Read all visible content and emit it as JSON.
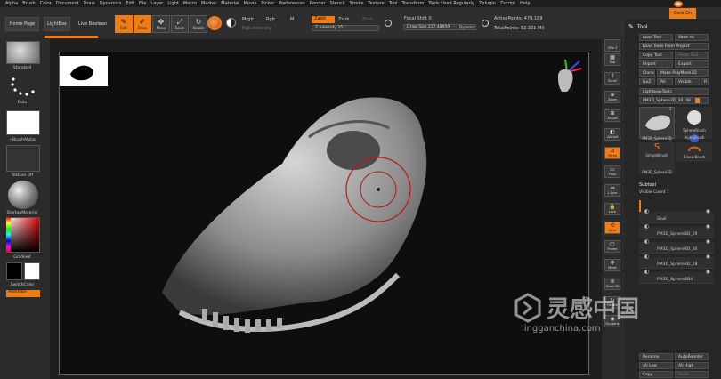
{
  "menu": [
    "Alpha",
    "Brush",
    "Color",
    "Document",
    "Draw",
    "Dynamics",
    "Edit",
    "File",
    "Layer",
    "Light",
    "Macro",
    "Marker",
    "Material",
    "Movie",
    "Picker",
    "Preferences",
    "Render",
    "Stencil",
    "Stroke",
    "Texture",
    "Tool",
    "Transform",
    "Tools Used Regularly",
    "Zplugin",
    "Zscript",
    "Help"
  ],
  "coords": "-1.253 0.346,-1.336",
  "tabs": {
    "home": "Home Page",
    "lightbox": "LightBox",
    "live_boolean": "Live Boolean"
  },
  "toolbar": {
    "edit": "Edit",
    "draw": "Draw",
    "move": "Move",
    "scale": "Scale",
    "rotate": "Rotate",
    "mrgb": "Mrgb",
    "rgb": "Rgb",
    "m": "M",
    "rgb_intensity": "Rgb Intensity",
    "zadd": "Zadd",
    "zsub": "Zsub",
    "zcut": "Zcut",
    "z_intensity": "Z Intensity 25",
    "focal_shift": "Focal Shift 0",
    "draw_size": "Draw Size 217.48959",
    "dynamic": "Dynamic",
    "active_points": "ActivePoints: 479,189",
    "total_points": "TotalPoints: 52.321 Mil"
  },
  "colors": {
    "accent": "#f07d14",
    "background": "#2a2a2a"
  },
  "top_right": {
    "core_on": "Core On"
  },
  "left_shelf": {
    "standard": "Standard",
    "dots": "Dots",
    "brush_alpha": "~BrushAlpha",
    "texture_off": "Texture Off",
    "startup_material": "StartupMaterial",
    "gradient": "Gradient",
    "switch_color": "SwitchColor",
    "alternate": "Alternate"
  },
  "right_shelf": [
    "Sub",
    "Scroll",
    "Zoom",
    "Actual",
    "AAHalf",
    "Persp",
    "Floor",
    "L.Sym",
    "Lock",
    "Qxyz",
    "Frame",
    "Move",
    "Zoom3D",
    "Rotate",
    "Sculptris"
  ],
  "right_shelf_top": "SPix 3",
  "tool_palette": {
    "title": "Tool",
    "load_tool": "Load Tool",
    "save_as": "Save As",
    "load_from_project": "Load Tools From Project",
    "copy_tool": "Copy Tool",
    "paste_tool": "Paste Tool",
    "import": "Import",
    "export": "Export",
    "clone": "Clone",
    "make_polymesh": "Make PolyMesh3D",
    "goz": "GoZ",
    "all": "All",
    "visible": "Visible",
    "r": "R",
    "lightbox_tools": "Lightbox▸Tools",
    "current_tool": "PM3D_Sphere3D_30. 48",
    "thumb_pm3d": "PM3D_Sphere3D",
    "sphere_brush": "SphereBrush",
    "alpha_brush": "AlphaBrush",
    "simple_brush": "SimpleBrush",
    "eraser_brush": "EraserBrush",
    "thumb_count": "2",
    "subtool_title": "Subtool",
    "visible_count": "Visible Count 7",
    "subtools": [
      "Skull",
      "PM3D_Sphere3D_29",
      "PM3D_Sphere3D_30",
      "PM3D_Sphere3D_28",
      "PM3D_Sphere3D4"
    ],
    "rename": "Rename",
    "autoreorder": "AutoReorder",
    "all_low": "All Low",
    "all_high": "All High",
    "copy": "Copy",
    "paste": "Paste"
  },
  "watermark": {
    "cn": "灵感中国",
    "url": "lingganchina.com"
  }
}
